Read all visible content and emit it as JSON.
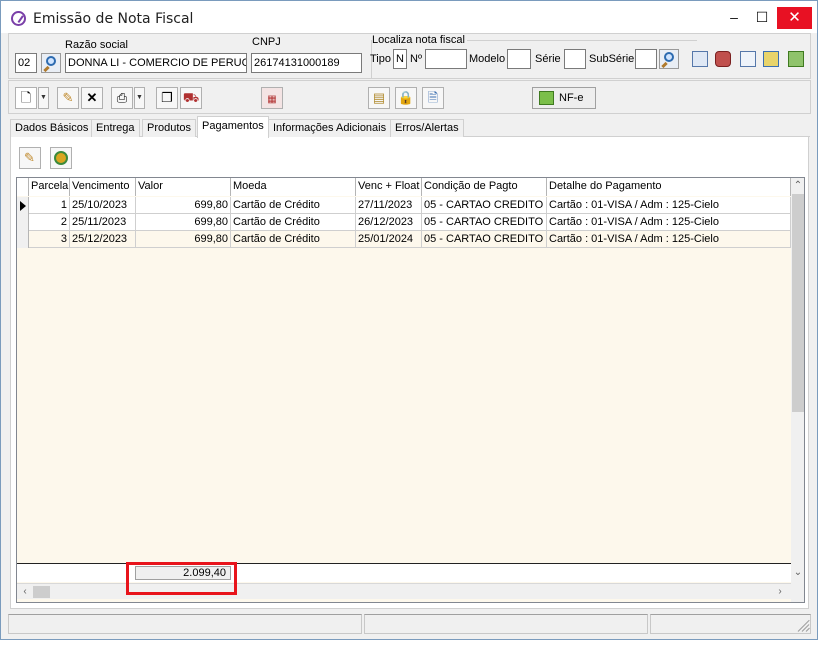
{
  "window": {
    "title": "Emissão de Nota Fiscal",
    "minimize": "–",
    "maximize": "☐",
    "close": "✕"
  },
  "header": {
    "code_value": "02",
    "razao_label": "Razão social",
    "razao_value": "DONNA LI - COMERCIO DE PERUCAS",
    "cnpj_label": "CNPJ",
    "cnpj_value": "26174131000189",
    "localiza_label": "Localiza nota fiscal",
    "tipo_label": "Tipo",
    "tipo_value": "N",
    "numero_label": "Nº",
    "numero_value": "",
    "modelo_label": "Modelo",
    "modelo_value": "",
    "serie_label": "Série",
    "serie_value": "",
    "subserie_label": "SubSérie",
    "subserie_value": ""
  },
  "toolbar": {
    "nfe_label": "NF-e"
  },
  "tabs": [
    {
      "label": "Dados Básicos"
    },
    {
      "label": "Entrega"
    },
    {
      "label": "Produtos"
    },
    {
      "label": "Pagamentos"
    },
    {
      "label": "Informações Adicionais"
    },
    {
      "label": "Erros/Alertas"
    }
  ],
  "active_tab": "Pagamentos",
  "grid": {
    "columns": [
      "Parcela",
      "Vencimento",
      "Valor",
      "Moeda",
      "Venc + Float",
      "Condição de Pagto",
      "Detalhe do Pagamento"
    ],
    "rows": [
      {
        "parcela": "1",
        "vencimento": "25/10/2023",
        "valor": "699,80",
        "moeda": "Cartão de Crédito",
        "venc_float": "27/11/2023",
        "condicao": "05 - CARTAO CREDITO",
        "detalhe": "Cartão : 01-VISA / Adm : 125-Cielo"
      },
      {
        "parcela": "2",
        "vencimento": "25/11/2023",
        "valor": "699,80",
        "moeda": "Cartão de Crédito",
        "venc_float": "26/12/2023",
        "condicao": "05 - CARTAO CREDITO",
        "detalhe": "Cartão : 01-VISA / Adm : 125-Cielo"
      },
      {
        "parcela": "3",
        "vencimento": "25/12/2023",
        "valor": "699,80",
        "moeda": "Cartão de Crédito",
        "venc_float": "25/01/2024",
        "condicao": "05 - CARTAO CREDITO",
        "detalhe": "Cartão : 01-VISA / Adm : 125-Cielo"
      }
    ],
    "total": "2.099,40"
  },
  "colors": {
    "highlight": "#e8141b",
    "close_button": "#e81123",
    "row_alt": "#fdf8ec"
  }
}
